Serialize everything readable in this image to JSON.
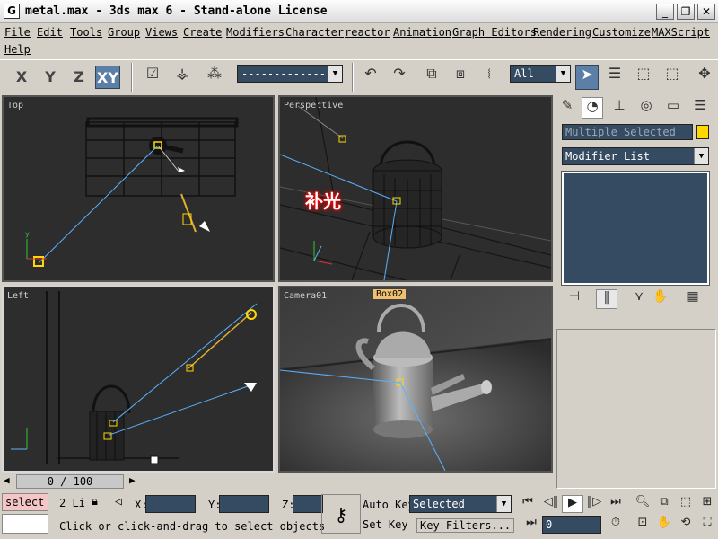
{
  "window": {
    "title": "metal.max - 3ds max 6 - Stand-alone License",
    "app_icon": "G"
  },
  "menu": [
    "File",
    "Edit",
    "Tools",
    "Group",
    "Views",
    "Create",
    "Modifiers",
    "Character",
    "reactor",
    "Animation",
    "Graph Editors",
    "Rendering",
    "Customize",
    "MAXScript",
    "Help"
  ],
  "toolbar": {
    "axes": [
      "X",
      "Y",
      "Z",
      "XY"
    ],
    "selection_set": "-------------",
    "filter": "All"
  },
  "viewports": {
    "top": "Top",
    "perspective": "Perspective",
    "left": "Left",
    "camera": "Camera01",
    "annotation": "补光",
    "camera_object_label": "Box02"
  },
  "command_panel": {
    "selection_name": "Multiple Selected",
    "modifier_list": "Modifier List",
    "selection_color": "#ffd800"
  },
  "time": {
    "current": 0,
    "end": 100,
    "display": "0 / 100"
  },
  "status": {
    "mode": "select",
    "selection_count": "2 Li",
    "x_label": "X:",
    "y_label": "Y:",
    "z_label": "Z:",
    "auto_key": "Auto Key",
    "set_key": "Set Key",
    "key_mode": "Selected",
    "key_filters": "Key Filters...",
    "frame": "0",
    "prompt": "Click or click-and-drag to select objects"
  }
}
